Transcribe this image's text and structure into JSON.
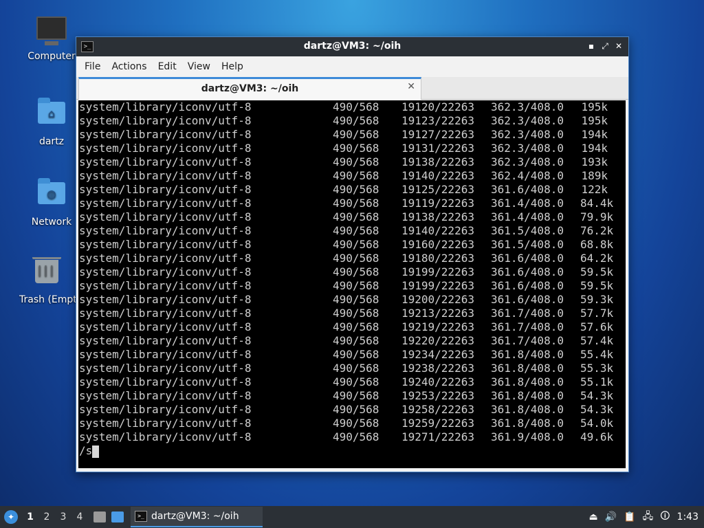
{
  "desktop": {
    "icons": [
      {
        "label": "Computer"
      },
      {
        "label": "dartz"
      },
      {
        "label": "Network"
      },
      {
        "label": "Trash (Empty)"
      }
    ]
  },
  "window": {
    "title": "dartz@VM3: ~/oih",
    "controls": {
      "minimize": "▪",
      "maximize": "⤢",
      "close": "✕"
    },
    "menu": [
      "File",
      "Actions",
      "Edit",
      "View",
      "Help"
    ],
    "tab": {
      "label": "dartz@VM3: ~/oih",
      "close": "✕"
    },
    "terminal": {
      "rows": [
        {
          "path": "system/library/iconv/utf-8",
          "a": "490/568",
          "b": "19120/22263",
          "c": "362.3/408.0",
          "d": "195k"
        },
        {
          "path": "system/library/iconv/utf-8",
          "a": "490/568",
          "b": "19123/22263",
          "c": "362.3/408.0",
          "d": "195k"
        },
        {
          "path": "system/library/iconv/utf-8",
          "a": "490/568",
          "b": "19127/22263",
          "c": "362.3/408.0",
          "d": "194k"
        },
        {
          "path": "system/library/iconv/utf-8",
          "a": "490/568",
          "b": "19131/22263",
          "c": "362.3/408.0",
          "d": "194k"
        },
        {
          "path": "system/library/iconv/utf-8",
          "a": "490/568",
          "b": "19138/22263",
          "c": "362.3/408.0",
          "d": "193k"
        },
        {
          "path": "system/library/iconv/utf-8",
          "a": "490/568",
          "b": "19140/22263",
          "c": "362.4/408.0",
          "d": "189k"
        },
        {
          "path": "system/library/iconv/utf-8",
          "a": "490/568",
          "b": "19125/22263",
          "c": "361.6/408.0",
          "d": "122k"
        },
        {
          "path": "system/library/iconv/utf-8",
          "a": "490/568",
          "b": "19119/22263",
          "c": "361.4/408.0",
          "d": "84.4k"
        },
        {
          "path": "system/library/iconv/utf-8",
          "a": "490/568",
          "b": "19138/22263",
          "c": "361.4/408.0",
          "d": "79.9k"
        },
        {
          "path": "system/library/iconv/utf-8",
          "a": "490/568",
          "b": "19140/22263",
          "c": "361.5/408.0",
          "d": "76.2k"
        },
        {
          "path": "system/library/iconv/utf-8",
          "a": "490/568",
          "b": "19160/22263",
          "c": "361.5/408.0",
          "d": "68.8k"
        },
        {
          "path": "system/library/iconv/utf-8",
          "a": "490/568",
          "b": "19180/22263",
          "c": "361.6/408.0",
          "d": "64.2k"
        },
        {
          "path": "system/library/iconv/utf-8",
          "a": "490/568",
          "b": "19199/22263",
          "c": "361.6/408.0",
          "d": "59.5k"
        },
        {
          "path": "system/library/iconv/utf-8",
          "a": "490/568",
          "b": "19199/22263",
          "c": "361.6/408.0",
          "d": "59.5k"
        },
        {
          "path": "system/library/iconv/utf-8",
          "a": "490/568",
          "b": "19200/22263",
          "c": "361.6/408.0",
          "d": "59.3k"
        },
        {
          "path": "system/library/iconv/utf-8",
          "a": "490/568",
          "b": "19213/22263",
          "c": "361.7/408.0",
          "d": "57.7k"
        },
        {
          "path": "system/library/iconv/utf-8",
          "a": "490/568",
          "b": "19219/22263",
          "c": "361.7/408.0",
          "d": "57.6k"
        },
        {
          "path": "system/library/iconv/utf-8",
          "a": "490/568",
          "b": "19220/22263",
          "c": "361.7/408.0",
          "d": "57.4k"
        },
        {
          "path": "system/library/iconv/utf-8",
          "a": "490/568",
          "b": "19234/22263",
          "c": "361.8/408.0",
          "d": "55.4k"
        },
        {
          "path": "system/library/iconv/utf-8",
          "a": "490/568",
          "b": "19238/22263",
          "c": "361.8/408.0",
          "d": "55.3k"
        },
        {
          "path": "system/library/iconv/utf-8",
          "a": "490/568",
          "b": "19240/22263",
          "c": "361.8/408.0",
          "d": "55.1k"
        },
        {
          "path": "system/library/iconv/utf-8",
          "a": "490/568",
          "b": "19253/22263",
          "c": "361.8/408.0",
          "d": "54.3k"
        },
        {
          "path": "system/library/iconv/utf-8",
          "a": "490/568",
          "b": "19258/22263",
          "c": "361.8/408.0",
          "d": "54.3k"
        },
        {
          "path": "system/library/iconv/utf-8",
          "a": "490/568",
          "b": "19259/22263",
          "c": "361.8/408.0",
          "d": "54.0k"
        },
        {
          "path": "system/library/iconv/utf-8",
          "a": "490/568",
          "b": "19271/22263",
          "c": "361.9/408.0",
          "d": "49.6k"
        }
      ],
      "prompt": "/s"
    }
  },
  "taskbar": {
    "workspaces": [
      "1",
      "2",
      "3",
      "4"
    ],
    "task_label": "dartz@VM3: ~/oih",
    "clock": "1:43"
  },
  "colors": {
    "accent": "#3d8ad8",
    "terminal_bg": "#000000",
    "terminal_fg": "#cfcfcf",
    "panel": "#2b3036"
  }
}
